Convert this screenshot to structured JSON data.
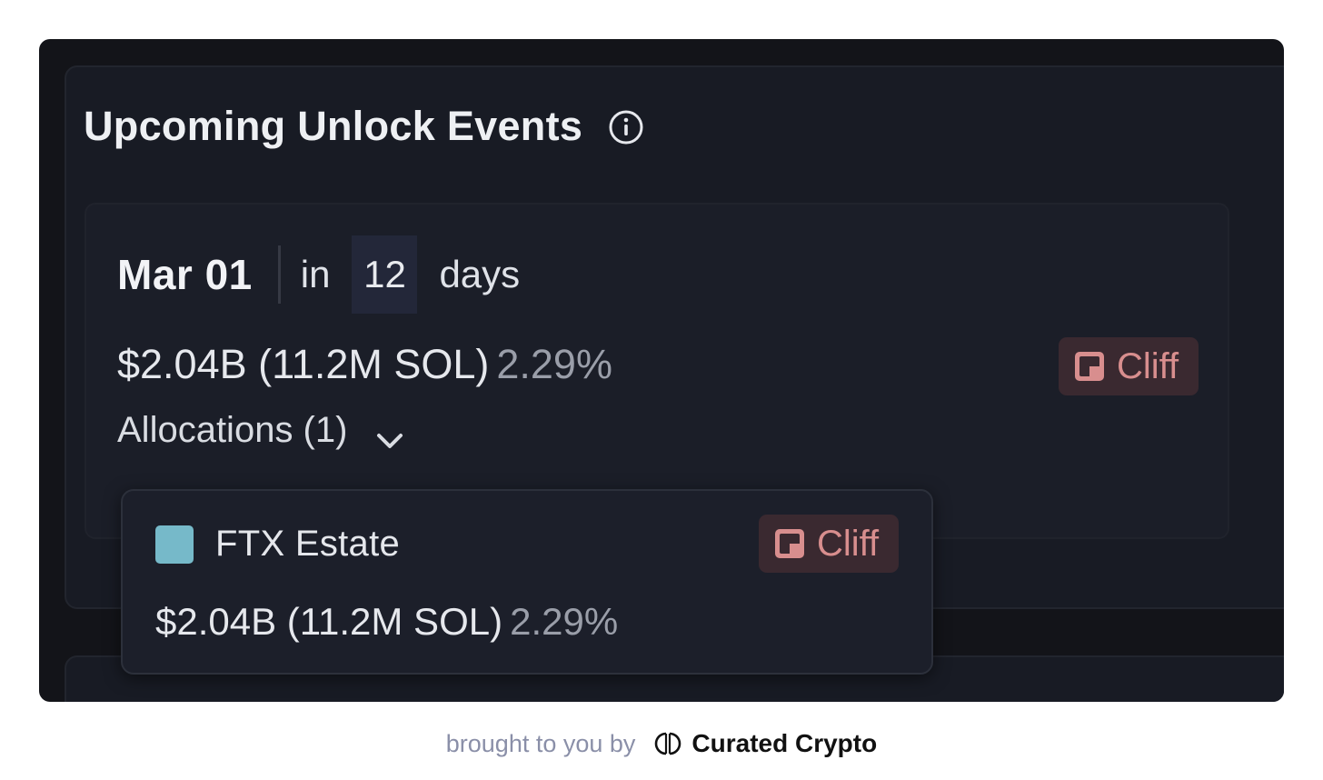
{
  "card": {
    "title": "Upcoming Unlock Events",
    "event": {
      "date": "Mar 01",
      "in_word": "in",
      "days_count": "12",
      "days_word": "days",
      "amount": "$2.04B (11.2M SOL)",
      "percent": "2.29%",
      "type_badge": "Cliff",
      "allocations_label": "Allocations (1)"
    },
    "allocation_popup": {
      "name": "FTX Estate",
      "swatch_color": "#76b9c9",
      "type_badge": "Cliff",
      "amount": "$2.04B (11.2M SOL)",
      "percent": "2.29%"
    }
  },
  "footer": {
    "prefix": "brought to you by",
    "brand": "Curated Crypto"
  },
  "colors": {
    "background": "#131419",
    "cliff_badge_text": "#d88e8e",
    "cliff_badge_bg": "#3a2930"
  },
  "icons": [
    "info-icon",
    "chevron-down-icon",
    "cliff-icon",
    "curated-crypto-logo-icon"
  ]
}
